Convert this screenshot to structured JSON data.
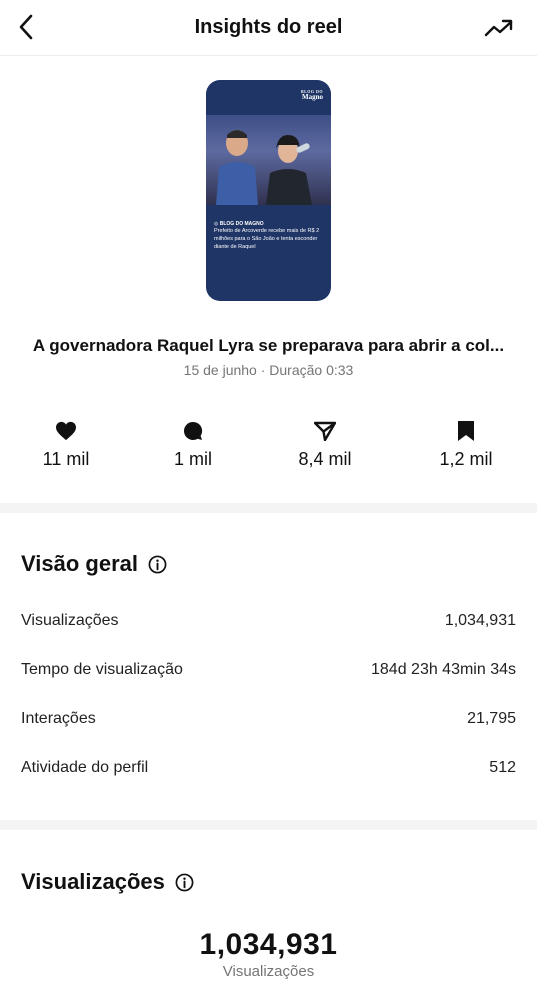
{
  "header": {
    "title": "Insights do reel",
    "back_icon": "back-arrow-icon",
    "trend_icon": "trending-up-icon"
  },
  "thumbnail": {
    "logo_small": "BLOG DO",
    "logo": "Magno",
    "caption_source": "◎ BLOG DO MAGNO",
    "caption_text": "Prefeito de Arcoverde recebe mais de R$ 2 milhões para o São João e tenta esconder diante de Raquel",
    "colors": {
      "background": "#1f3566"
    }
  },
  "reel": {
    "title": "A governadora Raquel Lyra se preparava para abrir a col...",
    "meta": "15 de junho · Duração 0:33"
  },
  "stats": [
    {
      "icon": "heart-icon",
      "value": "11 mil"
    },
    {
      "icon": "comment-icon",
      "value": "1 mil"
    },
    {
      "icon": "share-icon",
      "value": "8,4 mil"
    },
    {
      "icon": "bookmark-icon",
      "value": "1,2 mil"
    }
  ],
  "overview": {
    "title": "Visão geral",
    "info_icon": "info-icon",
    "rows": [
      {
        "label": "Visualizações",
        "value": "1,034,931"
      },
      {
        "label": "Tempo de visualização",
        "value": "184d 23h 43min 34s"
      },
      {
        "label": "Interações",
        "value": "21,795"
      },
      {
        "label": "Atividade do perfil",
        "value": "512"
      }
    ]
  },
  "views": {
    "title": "Visualizações",
    "info_icon": "info-icon",
    "total": "1,034,931",
    "total_label": "Visualizações"
  }
}
